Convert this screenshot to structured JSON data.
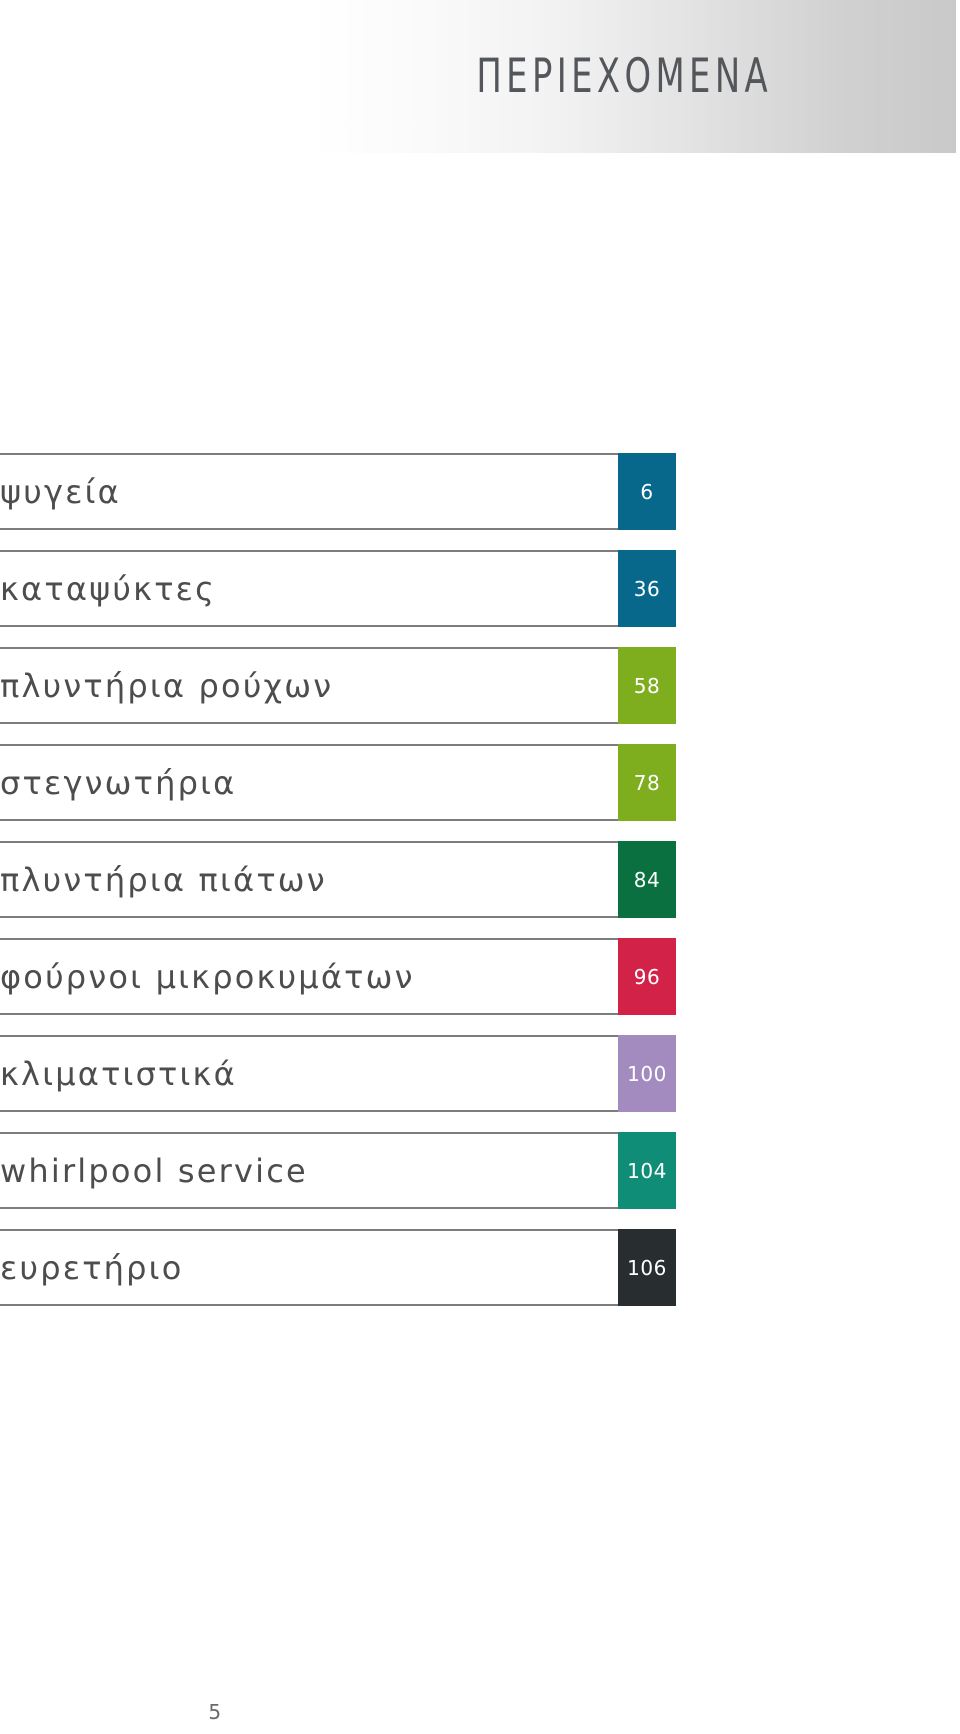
{
  "header": {
    "title": "ΠΕΡΙΕΧΟΜΕΝΑ",
    "gradient_from": "#ffffff",
    "gradient_to": "#c9c9c9",
    "title_color": "#53565a"
  },
  "toc": {
    "rule_color": "#7d7d7d",
    "label_color": "#4d4d4d",
    "page_number_text_color": "#ffffff",
    "entries": [
      {
        "label": "ψυγεία",
        "page": "6",
        "color": "#08688c"
      },
      {
        "label": "καταψύκτες",
        "page": "36",
        "color": "#08688c"
      },
      {
        "label": "πλυντήρια ρούχων",
        "page": "58",
        "color": "#7ead1e"
      },
      {
        "label": "στεγνωτήρια",
        "page": "78",
        "color": "#7ead1e"
      },
      {
        "label": "πλυντήρια πιάτων",
        "page": "84",
        "color": "#0b7040"
      },
      {
        "label": "φούρνοι μικροκυμάτων",
        "page": "96",
        "color": "#d32248"
      },
      {
        "label": "κλιματιστικά",
        "page": "100",
        "color": "#a38bc0"
      },
      {
        "label": "whirlpool service",
        "page": "104",
        "color": "#0f8d77"
      },
      {
        "label": "ευρετήριο",
        "page": "106",
        "color": "#282d2f"
      }
    ]
  },
  "footer": {
    "page_number": "5",
    "color": "#6b6b6b"
  }
}
